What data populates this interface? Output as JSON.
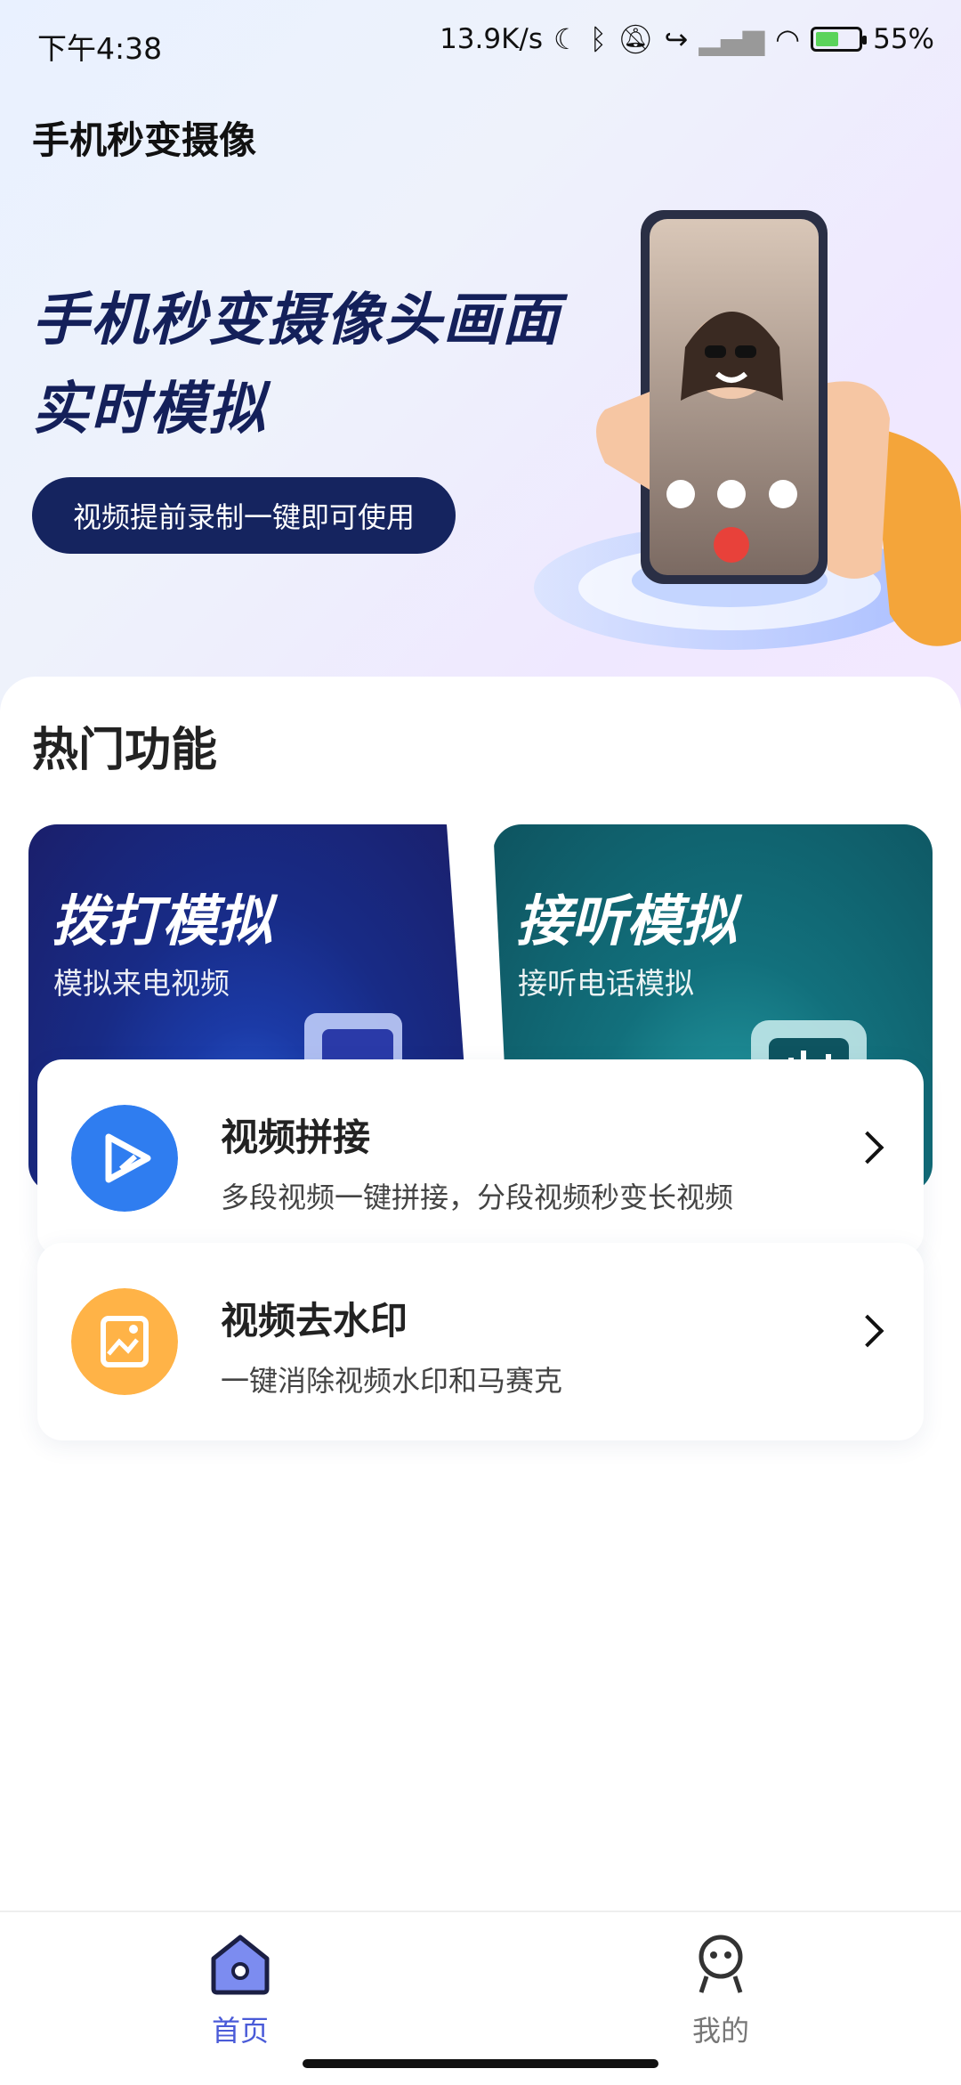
{
  "status_bar": {
    "time": "下午4:38",
    "speed": "13.9K/s",
    "battery": "55%",
    "battery_level": 0.55,
    "icons": [
      "moon-icon",
      "bluetooth-icon",
      "mute-bell-icon",
      "call-forward-icon",
      "signal-icon",
      "wifi-icon",
      "battery-icon"
    ]
  },
  "app_title": "手机秒变摄像",
  "hero": {
    "title_line1": "手机秒变摄像头画面",
    "title_line2": "实时模拟",
    "button_label": "视频提前录制一键即可使用"
  },
  "section_title": "热门功能",
  "feature_cards": [
    {
      "title": "拨打模拟",
      "subtitle": "模拟来电视频",
      "icon": "video-play-icon"
    },
    {
      "title": "接听模拟",
      "subtitle": "接听电话模拟",
      "icon": "voice-wave-icon"
    }
  ],
  "list_items": [
    {
      "title": "视频拼接",
      "subtitle": "多段视频一键拼接，分段视频秒变长视频",
      "icon": "video-splice-icon"
    },
    {
      "title": "视频去水印",
      "subtitle": "一键消除视频水印和马赛克",
      "icon": "watermark-remove-icon"
    }
  ],
  "bottom_nav": [
    {
      "label": "首页",
      "active": true
    },
    {
      "label": "我的",
      "active": false
    }
  ],
  "colors": {
    "accent": "#4a5bd8",
    "hero_dark": "#15245f",
    "dial_card": "#1b2f8f",
    "answer_card": "#12707c",
    "splice_icon": "#2f7df0",
    "watermark_icon": "#ffb347"
  }
}
